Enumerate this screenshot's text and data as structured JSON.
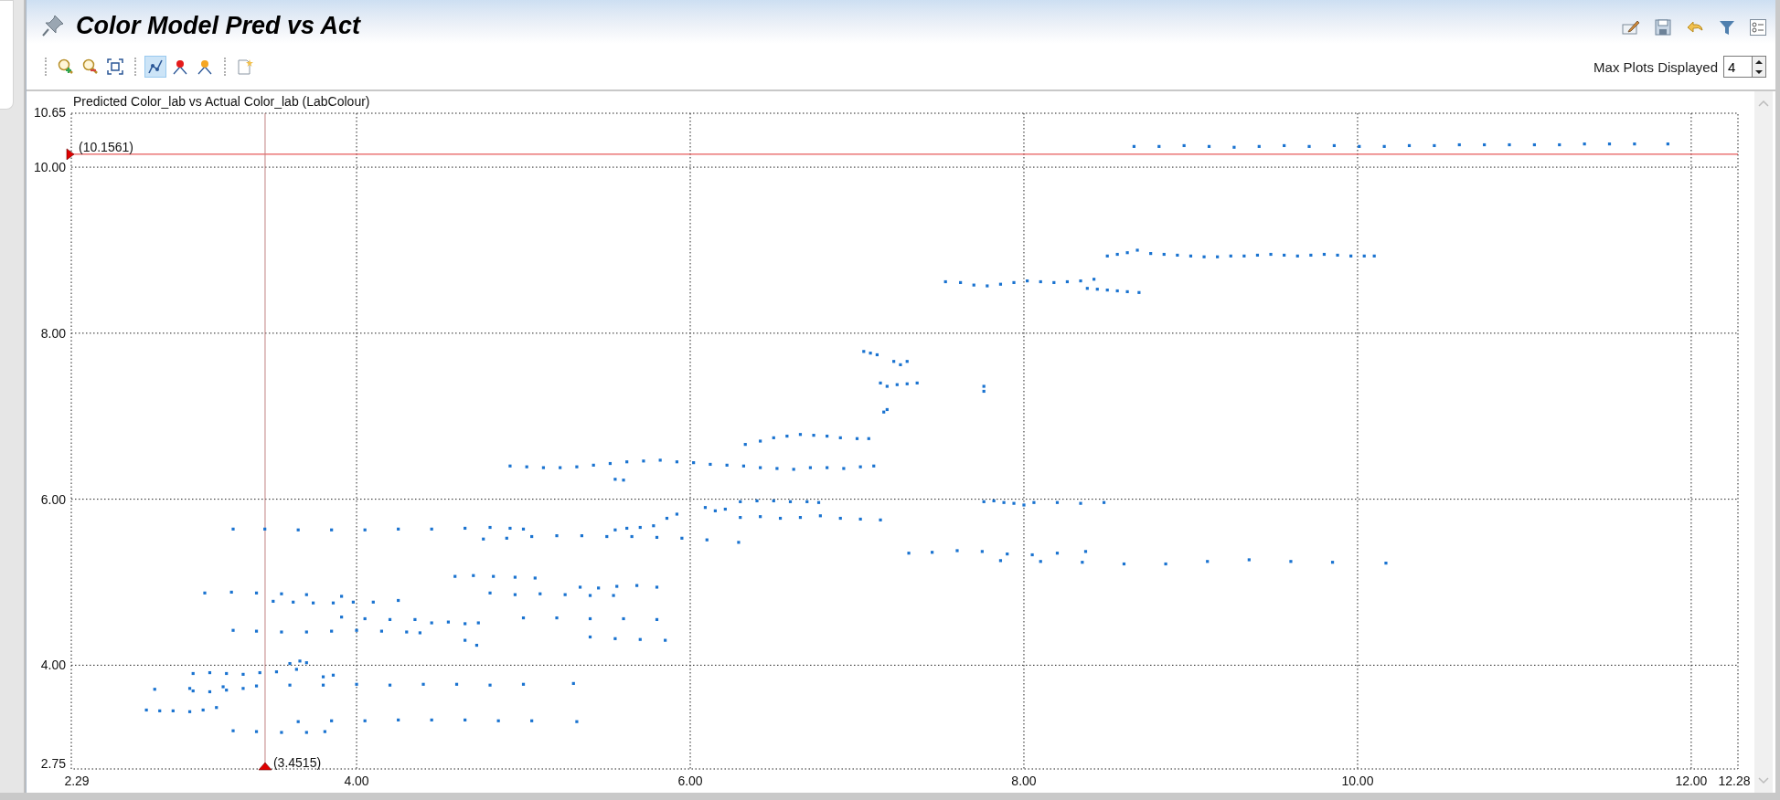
{
  "view": {
    "title": "Color Model Pred vs Act",
    "actions": [
      {
        "kind": "edit"
      },
      {
        "kind": "save"
      },
      {
        "kind": "undo"
      },
      {
        "kind": "filter"
      },
      {
        "kind": "list"
      }
    ]
  },
  "toolbar": {
    "groups": [
      [
        {
          "kind": "zoom-in",
          "selected": false
        },
        {
          "kind": "zoom-out",
          "selected": false
        },
        {
          "kind": "fit",
          "selected": false
        }
      ],
      [
        {
          "kind": "line",
          "selected": true
        },
        {
          "kind": "red-marker",
          "selected": false
        },
        {
          "kind": "orange-marker",
          "selected": false
        }
      ],
      [
        {
          "kind": "note",
          "selected": false
        }
      ]
    ]
  },
  "max_plots": {
    "label": "Max Plots Displayed",
    "value": "4"
  },
  "chart": {
    "chart_data": {
      "type": "scatter",
      "title": "Predicted Color_lab vs Actual Color_lab (LabColour)",
      "xlim": [
        2.29,
        12.28
      ],
      "ylim": [
        2.75,
        10.65
      ],
      "xticks": [
        {
          "value": 2.29,
          "label": "2.29"
        },
        {
          "value": 4,
          "label": "4.00"
        },
        {
          "value": 6,
          "label": "6.00"
        },
        {
          "value": 8,
          "label": "8.00"
        },
        {
          "value": 10,
          "label": "10.00"
        },
        {
          "value": 12,
          "label": "12.00"
        },
        {
          "value": 12.28,
          "label": "12.28"
        }
      ],
      "yticks": [
        {
          "value": 2.75,
          "label": "2.75"
        },
        {
          "value": 4,
          "label": "4.00"
        },
        {
          "value": 6,
          "label": "6.00"
        },
        {
          "value": 8,
          "label": "8.00"
        },
        {
          "value": 10,
          "label": "10.00"
        },
        {
          "value": 10.65,
          "label": "10.65"
        }
      ],
      "grid": true,
      "ref_lines": [
        {
          "axis": "y",
          "value": 10.1561,
          "label": "(10.1561)",
          "color": "#e03030"
        },
        {
          "axis": "x",
          "value": 3.4515,
          "label": "(3.4515)",
          "color": "#c08080"
        }
      ],
      "x": [
        8.66,
        8.81,
        8.96,
        9.11,
        9.26,
        9.41,
        9.56,
        9.71,
        9.86,
        10.01,
        10.16,
        10.31,
        10.46,
        10.61,
        10.76,
        10.91,
        11.06,
        11.21,
        11.36,
        11.51,
        11.66,
        11.86,
        8.5,
        8.56,
        8.62,
        8.68,
        8.76,
        8.84,
        8.92,
        9.0,
        9.08,
        9.16,
        9.24,
        9.32,
        9.4,
        9.48,
        9.56,
        9.64,
        9.72,
        9.8,
        9.88,
        9.96,
        10.04,
        10.1,
        7.53,
        7.62,
        7.7,
        7.78,
        7.86,
        7.94,
        8.02,
        8.1,
        8.18,
        8.26,
        8.34,
        8.42,
        8.38,
        8.44,
        8.5,
        8.56,
        8.62,
        8.69,
        7.04,
        7.08,
        7.12,
        7.22,
        7.26,
        7.3,
        7.14,
        7.18,
        7.24,
        7.3,
        7.36,
        7.16,
        7.18,
        7.76,
        7.76,
        6.33,
        6.42,
        6.5,
        6.58,
        6.66,
        6.74,
        6.82,
        6.9,
        7.0,
        7.07,
        4.92,
        5.02,
        5.12,
        5.22,
        5.32,
        5.42,
        5.52,
        5.62,
        5.72,
        5.82,
        5.92,
        6.02,
        6.12,
        6.22,
        6.32,
        6.42,
        6.52,
        6.62,
        6.72,
        6.82,
        6.92,
        7.02,
        7.1,
        5.55,
        5.6,
        7.76,
        7.82,
        7.88,
        7.94,
        8.0,
        8.06,
        8.2,
        8.34,
        8.48,
        6.09,
        6.15,
        6.21,
        6.3,
        6.4,
        6.5,
        6.6,
        6.7,
        6.77,
        6.3,
        6.42,
        6.54,
        6.66,
        6.78,
        6.9,
        7.02,
        7.14,
        3.26,
        3.45,
        3.65,
        3.85,
        4.05,
        4.25,
        4.45,
        4.65,
        4.8,
        4.92,
        5.0,
        5.55,
        5.62,
        5.7,
        5.78,
        5.86,
        5.92,
        4.76,
        4.9,
        5.05,
        5.2,
        5.35,
        5.5,
        5.65,
        5.8,
        5.95,
        6.1,
        6.29,
        7.31,
        7.45,
        7.6,
        7.75,
        7.9,
        8.05,
        8.2,
        8.37,
        7.86,
        8.1,
        8.35,
        8.6,
        8.85,
        9.1,
        9.35,
        9.6,
        9.85,
        10.17,
        4.59,
        4.7,
        4.82,
        4.95,
        5.07,
        5.34,
        5.45,
        5.56,
        5.68,
        5.8,
        3.09,
        3.25,
        3.4,
        3.55,
        3.7,
        3.91,
        4.8,
        4.95,
        5.1,
        5.25,
        5.4,
        5.54,
        3.5,
        3.62,
        3.74,
        3.86,
        3.98,
        4.1,
        4.25,
        3.91,
        4.05,
        4.2,
        4.35,
        4.45,
        4.55,
        4.65,
        4.73,
        5.0,
        5.2,
        5.4,
        5.6,
        5.8,
        3.26,
        3.4,
        3.55,
        3.7,
        3.85,
        4.0,
        4.15,
        4.3,
        4.38,
        4.65,
        4.72,
        5.4,
        5.55,
        5.7,
        5.85,
        3.6,
        3.66,
        3.7,
        3.02,
        3.12,
        3.22,
        3.32,
        3.42,
        3.52,
        3.64,
        3.8,
        3.86,
        2.79,
        3.0,
        3.2,
        3.4,
        3.6,
        3.8,
        4.0,
        4.2,
        4.4,
        4.6,
        4.8,
        5.0,
        5.3,
        3.02,
        3.12,
        3.22,
        3.32,
        2.74,
        2.82,
        2.9,
        3.0,
        3.08,
        3.16,
        3.65,
        3.85,
        4.05,
        4.25,
        4.45,
        4.65,
        4.85,
        5.05,
        5.32,
        3.26,
        3.4,
        3.55,
        3.7,
        3.81
      ],
      "series": [
        {
          "color": "#1a73d0",
          "values": [
            10.25,
            10.25,
            10.26,
            10.25,
            10.24,
            10.25,
            10.26,
            10.25,
            10.26,
            10.25,
            10.25,
            10.26,
            10.26,
            10.27,
            10.27,
            10.27,
            10.27,
            10.27,
            10.28,
            10.28,
            10.28,
            10.28,
            8.93,
            8.95,
            8.97,
            9.0,
            8.96,
            8.95,
            8.94,
            8.93,
            8.92,
            8.92,
            8.93,
            8.93,
            8.94,
            8.95,
            8.94,
            8.93,
            8.94,
            8.95,
            8.94,
            8.93,
            8.93,
            8.93,
            8.62,
            8.61,
            8.58,
            8.57,
            8.59,
            8.61,
            8.63,
            8.62,
            8.61,
            8.62,
            8.63,
            8.65,
            8.54,
            8.53,
            8.52,
            8.51,
            8.5,
            8.49,
            7.78,
            7.76,
            7.74,
            7.66,
            7.62,
            7.66,
            7.4,
            7.36,
            7.38,
            7.39,
            7.4,
            7.05,
            7.08,
            7.3,
            7.36,
            6.66,
            6.7,
            6.74,
            6.76,
            6.78,
            6.77,
            6.76,
            6.74,
            6.73,
            6.73,
            6.4,
            6.39,
            6.38,
            6.38,
            6.39,
            6.41,
            6.43,
            6.45,
            6.46,
            6.47,
            6.45,
            6.44,
            6.42,
            6.41,
            6.4,
            6.38,
            6.37,
            6.36,
            6.38,
            6.38,
            6.37,
            6.39,
            6.4,
            6.24,
            6.23,
            5.97,
            5.98,
            5.96,
            5.95,
            5.93,
            5.96,
            5.96,
            5.95,
            5.96,
            5.9,
            5.86,
            5.88,
            5.97,
            5.98,
            5.98,
            5.97,
            5.97,
            5.96,
            5.78,
            5.79,
            5.77,
            5.78,
            5.8,
            5.77,
            5.76,
            5.75,
            5.64,
            5.64,
            5.63,
            5.63,
            5.63,
            5.64,
            5.64,
            5.65,
            5.66,
            5.65,
            5.64,
            5.63,
            5.65,
            5.66,
            5.68,
            5.77,
            5.82,
            5.52,
            5.53,
            5.55,
            5.56,
            5.56,
            5.55,
            5.55,
            5.54,
            5.53,
            5.51,
            5.48,
            5.35,
            5.36,
            5.38,
            5.37,
            5.34,
            5.33,
            5.35,
            5.37,
            5.26,
            5.25,
            5.24,
            5.22,
            5.22,
            5.25,
            5.27,
            5.25,
            5.24,
            5.23,
            5.07,
            5.08,
            5.07,
            5.06,
            5.05,
            4.94,
            4.93,
            4.95,
            4.96,
            4.94,
            4.87,
            4.88,
            4.87,
            4.86,
            4.85,
            4.83,
            4.87,
            4.85,
            4.86,
            4.85,
            4.84,
            4.84,
            4.77,
            4.76,
            4.75,
            4.75,
            4.76,
            4.76,
            4.78,
            4.58,
            4.56,
            4.55,
            4.55,
            4.51,
            4.52,
            4.5,
            4.51,
            4.57,
            4.57,
            4.56,
            4.56,
            4.55,
            4.42,
            4.41,
            4.4,
            4.4,
            4.41,
            4.42,
            4.41,
            4.4,
            4.39,
            4.3,
            4.24,
            4.34,
            4.32,
            4.31,
            4.3,
            4.02,
            4.05,
            4.03,
            3.9,
            3.91,
            3.9,
            3.89,
            3.91,
            3.92,
            3.95,
            3.86,
            3.88,
            3.71,
            3.72,
            3.74,
            3.75,
            3.76,
            3.76,
            3.77,
            3.76,
            3.77,
            3.77,
            3.76,
            3.77,
            3.78,
            3.69,
            3.68,
            3.7,
            3.72,
            3.46,
            3.45,
            3.45,
            3.44,
            3.46,
            3.49,
            3.32,
            3.33,
            3.33,
            3.34,
            3.34,
            3.34,
            3.33,
            3.33,
            3.32,
            3.21,
            3.2,
            3.19,
            3.19,
            3.2
          ]
        }
      ]
    }
  }
}
